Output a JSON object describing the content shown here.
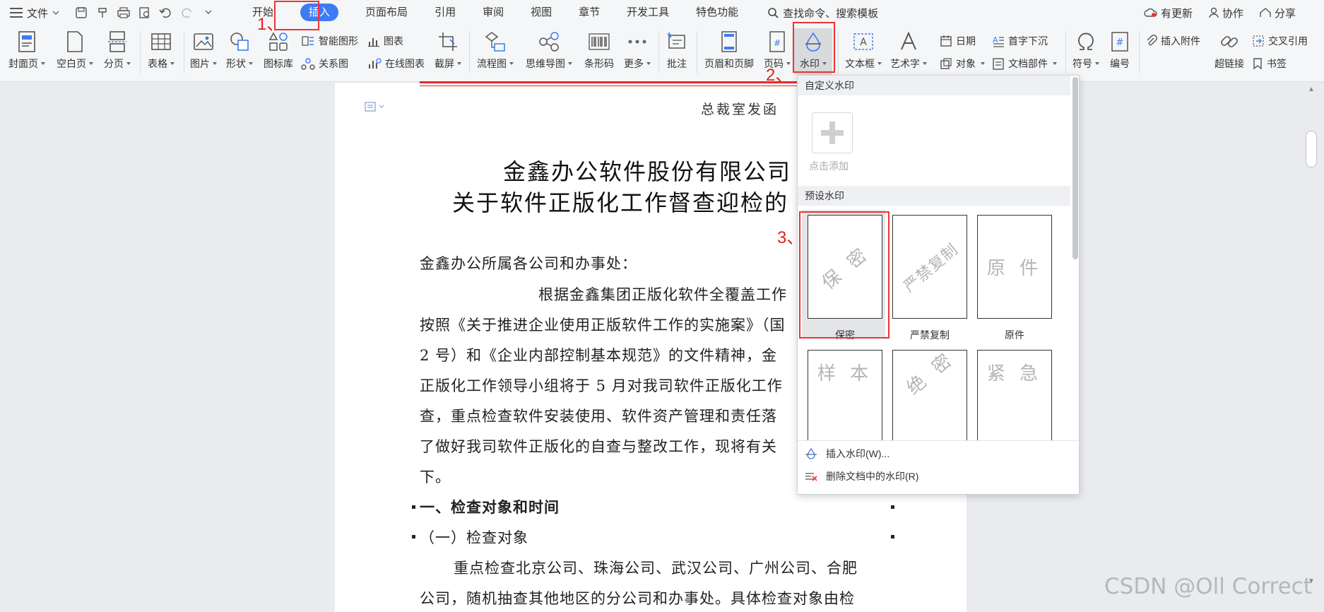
{
  "menubar": {
    "file_label": "文件",
    "tabs": [
      {
        "label": "开始"
      },
      {
        "label": "插入"
      },
      {
        "label": "页面布局"
      },
      {
        "label": "引用"
      },
      {
        "label": "审阅"
      },
      {
        "label": "视图"
      },
      {
        "label": "章节"
      },
      {
        "label": "开发工具"
      },
      {
        "label": "特色功能"
      }
    ],
    "search_label": "查找命令、搜索模板",
    "right": {
      "update": "有更新",
      "collab": "协作",
      "share": "分享"
    }
  },
  "ribbon": {
    "cover": "封面页",
    "blank": "空白页",
    "pagebreak": "分页",
    "table": "表格",
    "picture": "图片",
    "shape": "形状",
    "iconlib": "图标库",
    "smartart": "智能图形",
    "chart": "图表",
    "relation": "关系图",
    "onlinechart": "在线图表",
    "screenshot": "截屏",
    "flowchart": "流程图",
    "mindmap": "思维导图",
    "barcode": "条形码",
    "more": "更多",
    "comment": "批注",
    "headerfooter": "页眉和页脚",
    "pagenum": "页码",
    "watermark": "水印",
    "textbox": "文本框",
    "arttext": "艺术字",
    "date": "日期",
    "object": "对象",
    "dropcap": "首字下沉",
    "docparts": "文档部件",
    "symbol": "符号",
    "number": "编号",
    "attach": "插入附件",
    "hyperlink": "超链接",
    "crossref": "交叉引用",
    "bookmark": "书签"
  },
  "annotations": {
    "step1": "1、",
    "step2": "2、",
    "step3": "3、"
  },
  "document": {
    "header": "总裁室发函",
    "title1": "金鑫办公软件股份有限公司",
    "title2": "关于软件正版化工作督查迎检的",
    "lines": [
      "金鑫办公所属各公司和办事处：",
      "根据金鑫集团正版化软件全覆盖工作",
      "按照《关于推进企业使用正版软件工作的实施案》（国",
      "2 号）和《企业内部控制基本规范》的文件精神，金",
      "正版化工作领导小组将于 5 月对我司软件正版化工作",
      "查，重点检查软件安装使用、软件资产管理和责任落",
      "了做好我司软件正版化的自查与整改工作，现将有关",
      "下。",
      "一、检查对象和时间",
      "（一）检查对象",
      "重点检查北京公司、珠海公司、武汉公司、广州公司、合肥",
      "公司，随机抽查其他地区的分公司和办事处。具体检查对象由检"
    ]
  },
  "watermark_menu": {
    "custom_section": "自定义水印",
    "add_label": "点击添加",
    "preset_section": "预设水印",
    "presets": [
      {
        "text": "保 密",
        "label": "保密"
      },
      {
        "text": "严禁复制",
        "label": "严禁复制"
      },
      {
        "text": "原 件",
        "label": "原件"
      },
      {
        "text": "样 本",
        "label": ""
      },
      {
        "text": "绝 密",
        "label": ""
      },
      {
        "text": "紧 急",
        "label": ""
      }
    ],
    "insert_action": "插入水印(W)...",
    "delete_action": "删除文档中的水印(R)"
  },
  "footer_watermark": "CSDN @Oll Correct",
  "colors": {
    "accent": "#3d7bf5",
    "annotation": "#e32020"
  }
}
